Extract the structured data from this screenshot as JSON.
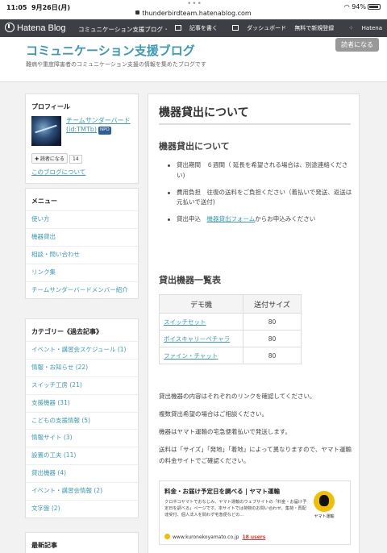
{
  "status_bar": {
    "time": "11:05",
    "date": "9月26日(月)",
    "dots": "•••",
    "url": "thunderbirdteam.hatenablog.com",
    "battery": "94%"
  },
  "hatena_bar": {
    "logo": "Hatena Blog",
    "blog_name": "コミュニケーション支援ブログ ･",
    "write": "記事を書く",
    "dashboard": "ダッシュボード",
    "signup": "無料で新規登録",
    "account": "Hatena"
  },
  "header": {
    "title": "コミュニケーション支援ブログ",
    "description": "難病や重度障害者のコミュニケーション支援の情報を集めたブログです",
    "reader_button": "読者になる"
  },
  "profile": {
    "heading": "プロフィール",
    "name": "チームサンダーバード (id:TMTb)",
    "badge": "NPO",
    "reader_button": "✚ 読者になる",
    "reader_count": "14",
    "about": "このブログについて"
  },
  "menu": {
    "heading": "メニュー",
    "items": [
      "使い方",
      "機器貸出",
      "相談・問い合わせ",
      "リンク集",
      "チームサンダーバードメンバー紹介"
    ]
  },
  "categories": {
    "heading": "カテゴリー《過去記事》",
    "items": [
      "イベント・講習会スケジュール (1)",
      "情報・お知らせ (22)",
      "スイッチ工房 (21)",
      "支援機器 (31)",
      "こどもの支援情報 (5)",
      "情報サイト (3)",
      "設置の工夫 (11)",
      "貸出機器 (4)",
      "イベント・講習会情報 (2)",
      "文字盤 (2)"
    ]
  },
  "recent": {
    "heading": "最新記事"
  },
  "article": {
    "title": "機器貸出について",
    "section1": "機器貸出について",
    "bullets": [
      {
        "text": "貸出期間　６週間（ 延長を希望される場合は、別途連絡ください)"
      },
      {
        "text": "費用負担　往復の送料をご負担ください（着払いで発送、返送は元払いで送付)"
      },
      {
        "prefix": "貸出申込　",
        "link": "機器貸出フォーム",
        "suffix": "からお申込みください"
      }
    ],
    "section2": "貸出機器一覧表",
    "table": {
      "headers": [
        "デモ機",
        "送付サイズ"
      ],
      "rows": [
        [
          "スイッチセット",
          "80"
        ],
        [
          "ボイスキャリーペチャラ",
          "80"
        ],
        [
          "ファイン・チャット",
          "80"
        ]
      ]
    },
    "paragraphs": [
      "貸出機器の内容はそれぞれのリンクを確認してください。",
      "複数貸出希望の場合はご相談ください。",
      "機器はヤマト運輸の宅急便着払いで発送します。",
      "送料は「サイズ」「発地」「着地」によって異なりますので、ヤマト運輸の料金サイトでご確認ください。"
    ],
    "card": {
      "title": "料金・お届け予定日を調べる | ヤマト運輸",
      "description": "クロネコヤマトでおなじみ、ヤマト運輸のウェブサイトの「料金・お届け予定日を調べる」ページです。本サイトでは荷物のお問い合わせ、集荷・再配達受付、個人法人を問わず宅急便などの...",
      "logo_label": "ヤマト運輸",
      "domain": "www.kuronekoyamato.co.jp",
      "users": "18 users"
    }
  }
}
